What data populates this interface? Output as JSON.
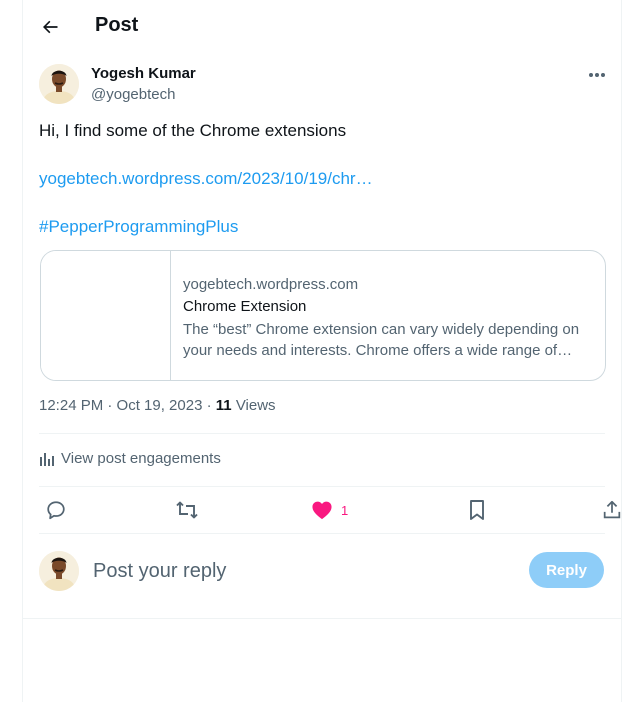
{
  "header": {
    "title": "Post",
    "back_icon": "arrow-left-icon"
  },
  "post": {
    "author_name": "Yogesh Kumar",
    "author_handle": "@yogebtech",
    "text": "Hi, I find some of the Chrome extensions",
    "link": "yogebtech.wordpress.com/2023/10/19/chr…",
    "hashtag": "#PepperProgrammingPlus",
    "card": {
      "domain": "yogebtech.wordpress.com",
      "title": "Chrome Extension",
      "description": "The “best” Chrome extension can vary widely depending on your needs and interests. Chrome offers a wide range of extensions"
    },
    "timestamp": "12:24 PM · Oct 19, 2023",
    "views_count": "11",
    "views_label": "Views"
  },
  "engagements_label": "View post engagements",
  "actions": {
    "reply_icon": "reply-icon",
    "repost_icon": "repost-icon",
    "like_icon": "heart-filled-icon",
    "like_count": "1",
    "bookmark_icon": "bookmark-icon",
    "share_icon": "share-icon"
  },
  "composer": {
    "placeholder": "Post your reply",
    "button_label": "Reply"
  },
  "colors": {
    "accent": "#1d9bf0",
    "like": "#f91880",
    "reply_button_disabled": "#8ecdf8",
    "text_primary": "#0f1419",
    "text_secondary": "#536471",
    "border": "#cfd9de"
  }
}
